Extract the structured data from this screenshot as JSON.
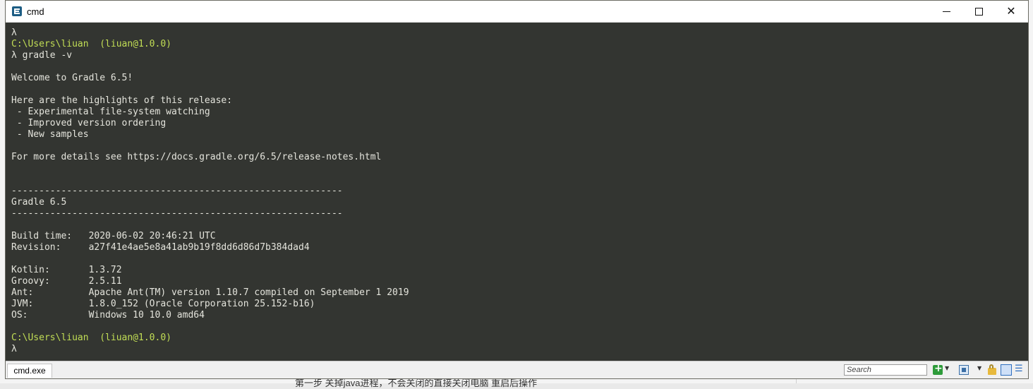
{
  "background_page": {
    "visible_text": "第一步 关掉java进程，不会关闭的直接关闭电脑 重启后操作"
  },
  "window": {
    "title": "cmd",
    "controls": {
      "minimize": "minimize",
      "maximize": "maximize",
      "close": "✕"
    }
  },
  "console": {
    "lines": [
      {
        "text": "λ",
        "kind": "prompt"
      },
      {
        "text": "C:\\Users\\liuan  (liuan@1.0.0)",
        "kind": "path"
      },
      {
        "text": "λ gradle -v",
        "kind": "prompt"
      },
      {
        "text": "",
        "kind": "out"
      },
      {
        "text": "Welcome to Gradle 6.5!",
        "kind": "out"
      },
      {
        "text": "",
        "kind": "out"
      },
      {
        "text": "Here are the highlights of this release:",
        "kind": "out"
      },
      {
        "text": " - Experimental file-system watching",
        "kind": "out"
      },
      {
        "text": " - Improved version ordering",
        "kind": "out"
      },
      {
        "text": " - New samples",
        "kind": "out"
      },
      {
        "text": "",
        "kind": "out"
      },
      {
        "text": "For more details see https://docs.gradle.org/6.5/release-notes.html",
        "kind": "out"
      },
      {
        "text": "",
        "kind": "out"
      },
      {
        "text": "",
        "kind": "out"
      },
      {
        "text": "------------------------------------------------------------",
        "kind": "out"
      },
      {
        "text": "Gradle 6.5",
        "kind": "out"
      },
      {
        "text": "------------------------------------------------------------",
        "kind": "out"
      },
      {
        "text": "",
        "kind": "out"
      },
      {
        "text": "Build time:   2020-06-02 20:46:21 UTC",
        "kind": "out"
      },
      {
        "text": "Revision:     a27f41e4ae5e8a41ab9b19f8dd6d86d7b384dad4",
        "kind": "out"
      },
      {
        "text": "",
        "kind": "out"
      },
      {
        "text": "Kotlin:       1.3.72",
        "kind": "out"
      },
      {
        "text": "Groovy:       2.5.11",
        "kind": "out"
      },
      {
        "text": "Ant:          Apache Ant(TM) version 1.10.7 compiled on September 1 2019",
        "kind": "out"
      },
      {
        "text": "JVM:          1.8.0_152 (Oracle Corporation 25.152-b16)",
        "kind": "out"
      },
      {
        "text": "OS:           Windows 10 10.0 amd64",
        "kind": "out"
      },
      {
        "text": "",
        "kind": "out"
      },
      {
        "text": "C:\\Users\\liuan  (liuan@1.0.0)",
        "kind": "path"
      },
      {
        "text": "λ",
        "kind": "prompt"
      }
    ]
  },
  "tabbar": {
    "active_tab": "cmd.exe",
    "search_placeholder": "Search",
    "icons": [
      "new-console-icon",
      "layout-icon",
      "lock-icon",
      "view-icon",
      "settings-icon"
    ]
  },
  "colors": {
    "console_bg": "#262824",
    "console_text": "#e4e4dc",
    "path_text": "#c2de55",
    "titlebar_bg": "#ffffff",
    "app_icon": "#1d5d84"
  }
}
